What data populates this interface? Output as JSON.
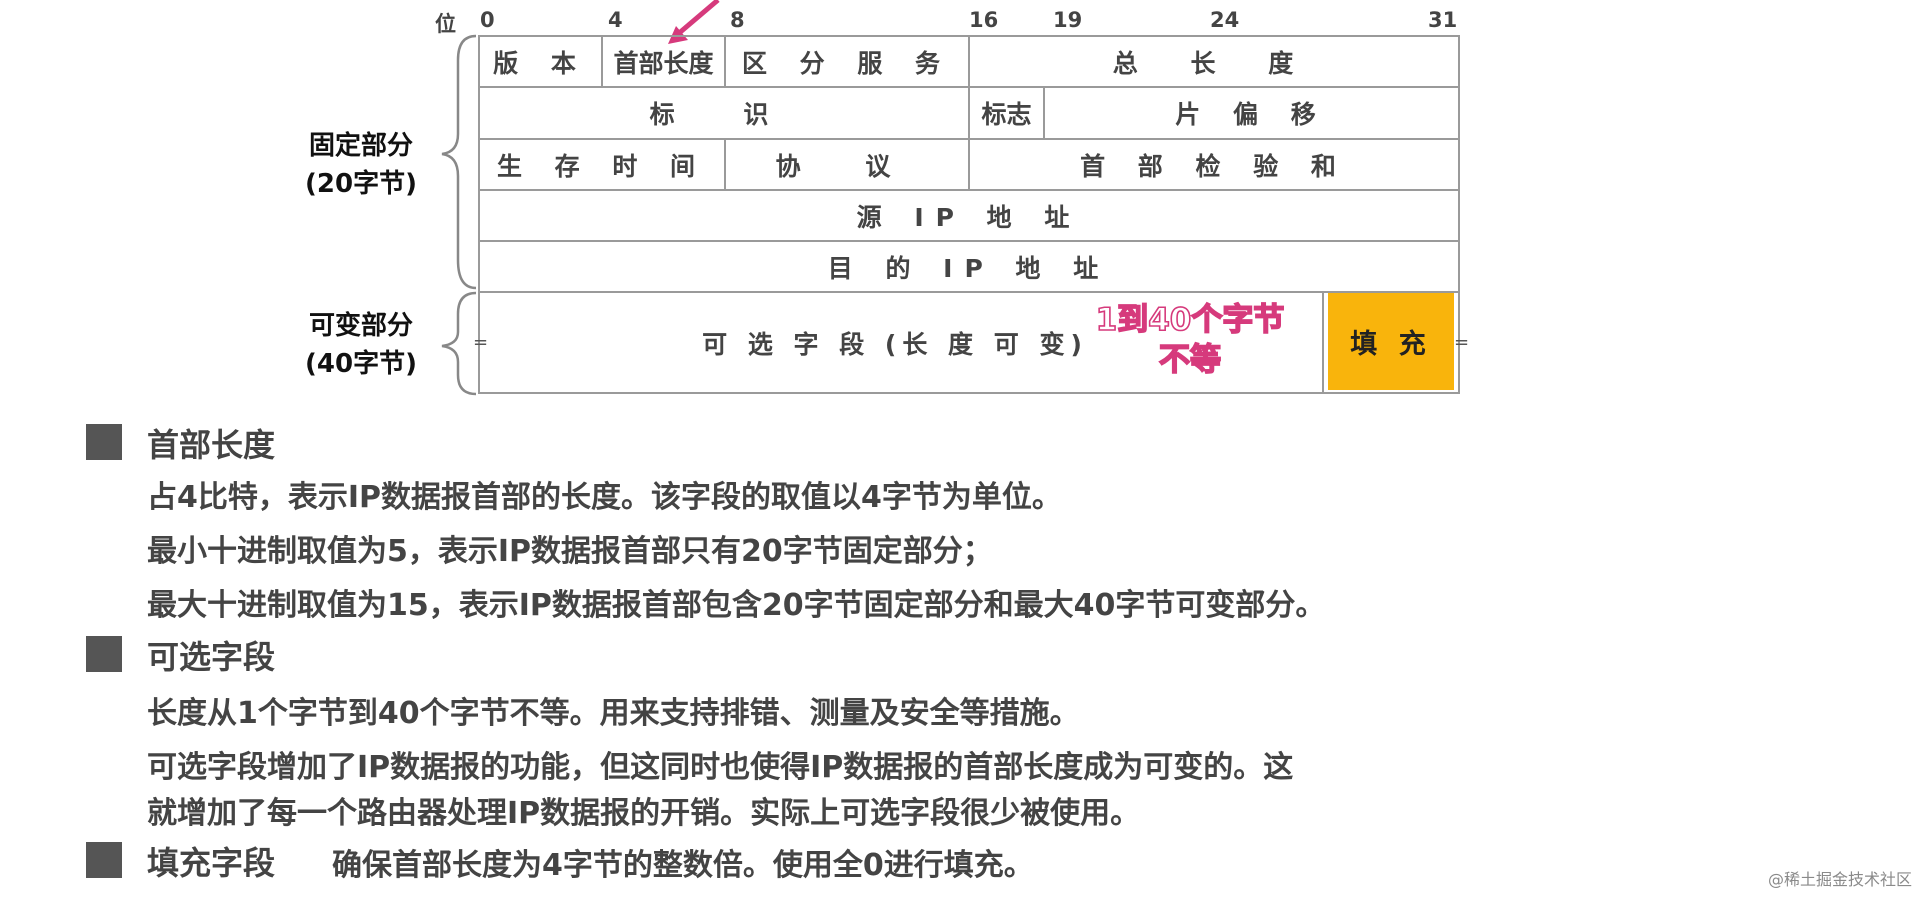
{
  "diagram": {
    "bit_label": "位",
    "bit_positions": [
      "0",
      "4",
      "8",
      "16",
      "19",
      "24",
      "31"
    ],
    "rows": [
      [
        {
          "id": "version",
          "text": "版 本"
        },
        {
          "id": "header-length",
          "text": "首部长度"
        },
        {
          "id": "diff-service",
          "text": "区 分 服 务"
        },
        {
          "id": "total-length",
          "text": "总 长 度"
        }
      ],
      [
        {
          "id": "identification",
          "text": "标 识"
        },
        {
          "id": "flags",
          "text": "标志"
        },
        {
          "id": "fragment-offset",
          "text": "片 偏 移"
        }
      ],
      [
        {
          "id": "ttl",
          "text": "生 存 时 间"
        },
        {
          "id": "protocol",
          "text": "协 议"
        },
        {
          "id": "checksum",
          "text": "首 部 检 验 和"
        }
      ],
      [
        {
          "id": "source-ip",
          "text": "源 IP 地 址"
        }
      ],
      [
        {
          "id": "dest-ip",
          "text": "目 的 IP 地 址"
        }
      ]
    ],
    "options_field": "可 选 字 段 (长 度 可 变)",
    "padding_field": "填 充",
    "fixed_part_label": [
      "固定部分",
      "(20字节)"
    ],
    "variable_part_label": [
      "可变部分",
      "(40字节)"
    ],
    "annotation": [
      "1到40个字节",
      "不等"
    ],
    "edge_mark": "=",
    "colors": {
      "padding": "#f9b40c",
      "annotation": "#d63a7c",
      "arrow": "#d63a7c",
      "lines": "#9a9a9a"
    }
  },
  "notes": [
    {
      "title": "首部长度",
      "lines": [
        "占4比特，表示IP数据报首部的长度。该字段的取值以4字节为单位。",
        "最小十进制取值为5，表示IP数据报首部只有20字节固定部分；",
        "最大十进制取值为15，表示IP数据报首部包含20字节固定部分和最大40字节可变部分。"
      ]
    },
    {
      "title": "可选字段",
      "lines": [
        "长度从1个字节到40个字节不等。用来支持排错、测量及安全等措施。",
        "可选字段增加了IP数据报的功能，但这同时也使得IP数据报的首部长度成为可变的。这",
        "就增加了每一个路由器处理IP数据报的开销。实际上可选字段很少被使用。"
      ]
    },
    {
      "title": "填充字段",
      "inline": "确保首部长度为4字节的整数倍。使用全0进行填充。"
    }
  ],
  "watermark": "@稀土掘金技术社区"
}
